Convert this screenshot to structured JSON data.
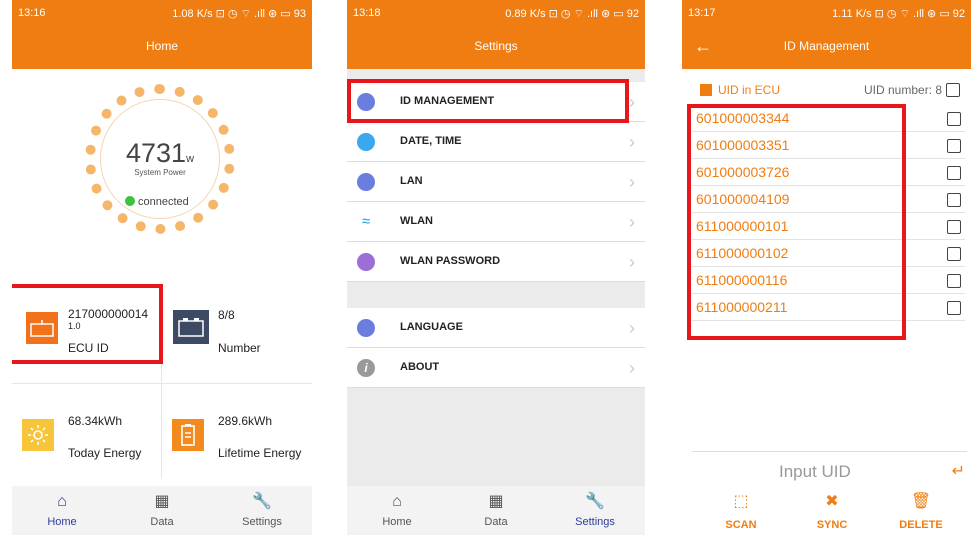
{
  "colors": {
    "accent": "#f07d12",
    "highlight": "#e8151b",
    "nav_active": "#2b3d9b"
  },
  "home": {
    "status": {
      "time": "13:16",
      "icons": "1.08 K/s  ⊡ ◷ ⌔ .ıll ⊛ ▭ 93"
    },
    "title": "Home",
    "power": {
      "value": "4731",
      "unit": "w",
      "label": "System Power",
      "status": "connected"
    },
    "tiles": {
      "ecu": {
        "value": "217000000014",
        "sub": "1.0",
        "label": "ECU ID"
      },
      "number": {
        "value": "8/8",
        "label": "Number"
      },
      "today": {
        "value": "68.34kWh",
        "label": "Today Energy"
      },
      "lifetime": {
        "value": "289.6kWh",
        "label": "Lifetime Energy"
      }
    },
    "nav": [
      {
        "label": "Home",
        "icon": "home-icon"
      },
      {
        "label": "Data",
        "icon": "data-grid-icon"
      },
      {
        "label": "Settings",
        "icon": "wrench-icon"
      }
    ]
  },
  "settings": {
    "status": {
      "time": "13:18",
      "icons": "0.89 K/s  ⊡ ◷ ⌔ .ıll ⊛ ▭ 92"
    },
    "title": "Settings",
    "items": [
      {
        "label": "ID MANAGEMENT",
        "icon": "id-management-icon"
      },
      {
        "label": "DATE, TIME",
        "icon": "clock-icon"
      },
      {
        "label": "LAN",
        "icon": "lan-icon"
      },
      {
        "label": "WLAN",
        "icon": "wifi-icon"
      },
      {
        "label": "WLAN PASSWORD",
        "icon": "lock-icon"
      },
      {
        "label": "LANGUAGE",
        "icon": "keyboard-icon"
      },
      {
        "label": "ABOUT",
        "icon": "info-icon"
      }
    ],
    "nav": [
      {
        "label": "Home",
        "icon": "home-icon"
      },
      {
        "label": "Data",
        "icon": "data-grid-icon"
      },
      {
        "label": "Settings",
        "icon": "wrench-icon"
      }
    ]
  },
  "idmgmt": {
    "status": {
      "time": "13:17",
      "icons": "1.11 K/s  ⊡ ◷ ⌔ .ıll ⊛ ▭ 92"
    },
    "title": "ID Management",
    "uid_in_ecu": "UID in ECU",
    "uid_number": "UID number: 8",
    "uids": [
      "601000003344",
      "601000003351",
      "601000003726",
      "601000004109",
      "611000000101",
      "611000000102",
      "611000000116",
      "611000000211"
    ],
    "input_placeholder": "Input UID",
    "actions": [
      {
        "label": "SCAN",
        "icon": "scan-icon"
      },
      {
        "label": "SYNC",
        "icon": "sync-icon"
      },
      {
        "label": "DELETE",
        "icon": "trash-icon"
      }
    ]
  }
}
